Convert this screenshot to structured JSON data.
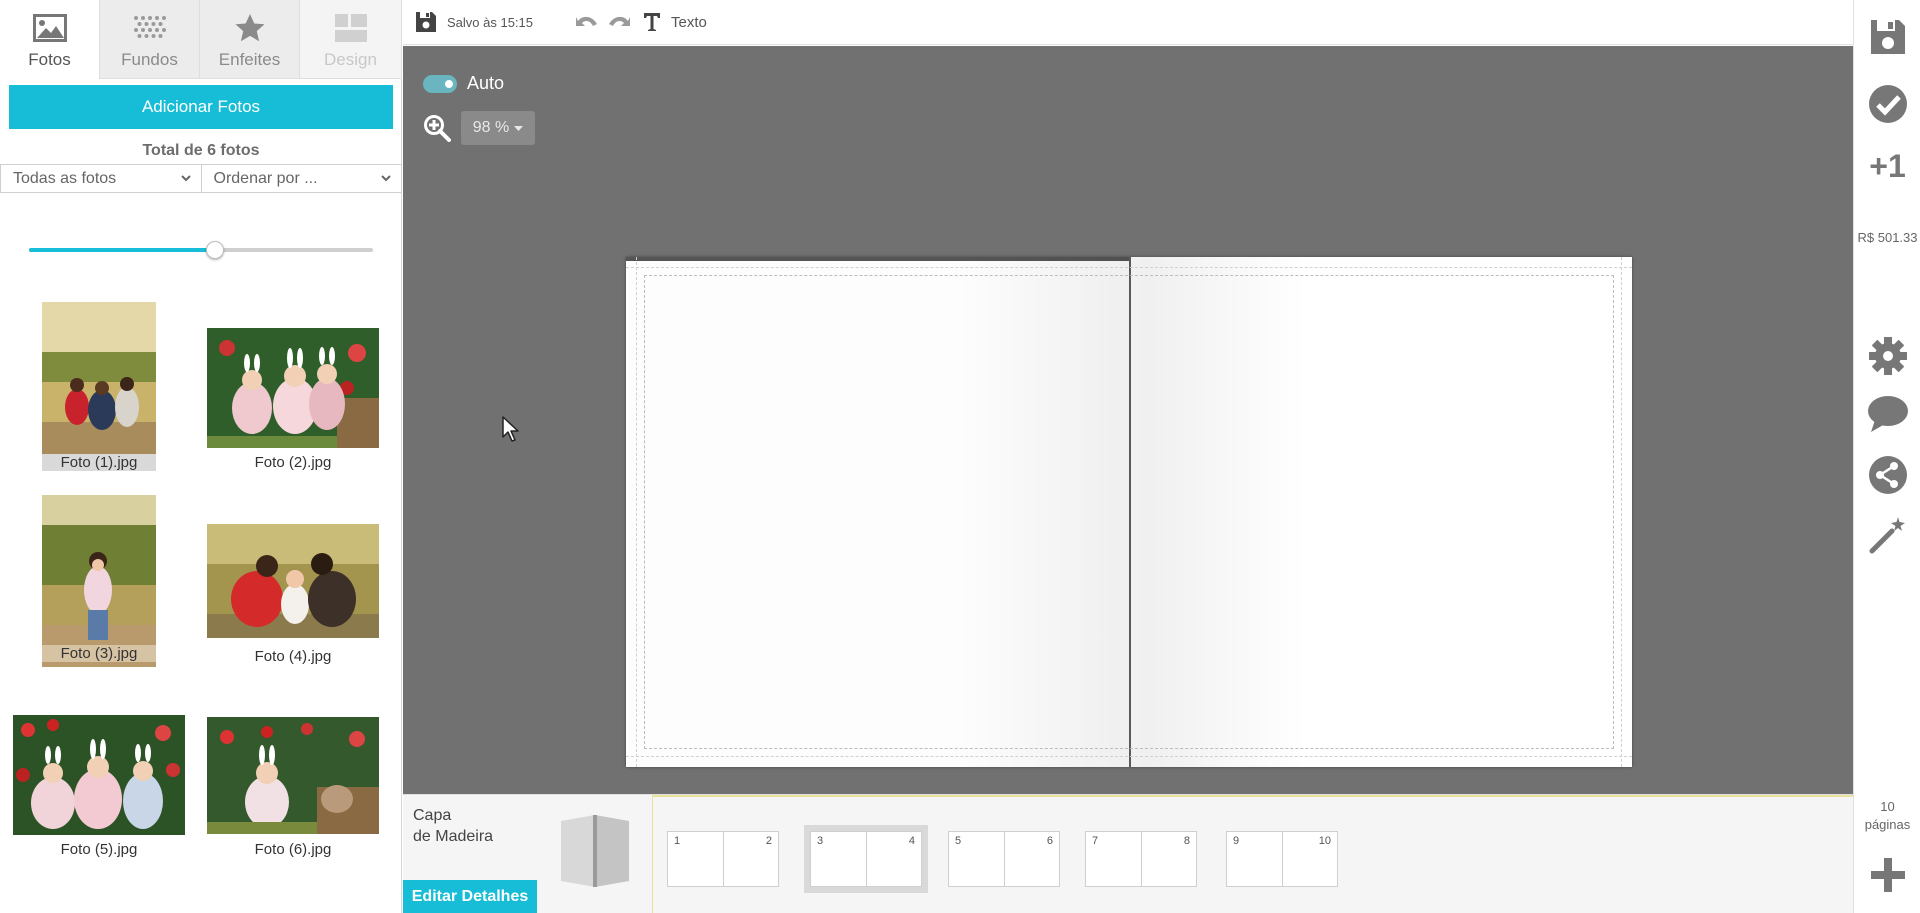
{
  "colors": {
    "accent": "#17bdd6",
    "canvas": "#717171",
    "toggle": "#6ab5bf"
  },
  "left_panel": {
    "tabs": [
      {
        "label": "Fotos",
        "icon": "image-icon",
        "state": "active"
      },
      {
        "label": "Fundos",
        "icon": "pattern-icon",
        "state": "normal"
      },
      {
        "label": "Enfeites",
        "icon": "star-icon",
        "state": "normal"
      },
      {
        "label": "Design",
        "icon": "layout-icon",
        "state": "disabled"
      }
    ],
    "add_photos_label": "Adicionar Fotos",
    "total_label": "Total de 6 fotos",
    "filter_select": "Todas as fotos",
    "order_select": "Ordenar por ...",
    "size_slider_value": 0.54,
    "photos": [
      {
        "caption": "Foto (1).jpg"
      },
      {
        "caption": "Foto (2).jpg"
      },
      {
        "caption": "Foto (3).jpg"
      },
      {
        "caption": "Foto (4).jpg"
      },
      {
        "caption": "Foto (5).jpg"
      },
      {
        "caption": "Foto (6).jpg"
      }
    ]
  },
  "toolbar": {
    "saved_label": "Salvo às 15:15",
    "text_label": "Texto"
  },
  "canvas": {
    "auto_label": "Auto",
    "auto_on": true,
    "zoom_value": "98 %"
  },
  "right_bar": {
    "price": "R$ 501.33",
    "plus_one_label": "+1",
    "pages_count": "10",
    "pages_label": "páginas"
  },
  "bottom": {
    "cover_title_line1": "Capa",
    "cover_title_line2": "de Madeira",
    "edit_details_label": "Editar Detalhes",
    "spreads": [
      {
        "left": "1",
        "right": "2"
      },
      {
        "left": "3",
        "right": "4"
      },
      {
        "left": "5",
        "right": "6"
      },
      {
        "left": "7",
        "right": "8"
      },
      {
        "left": "9",
        "right": "10"
      }
    ]
  }
}
